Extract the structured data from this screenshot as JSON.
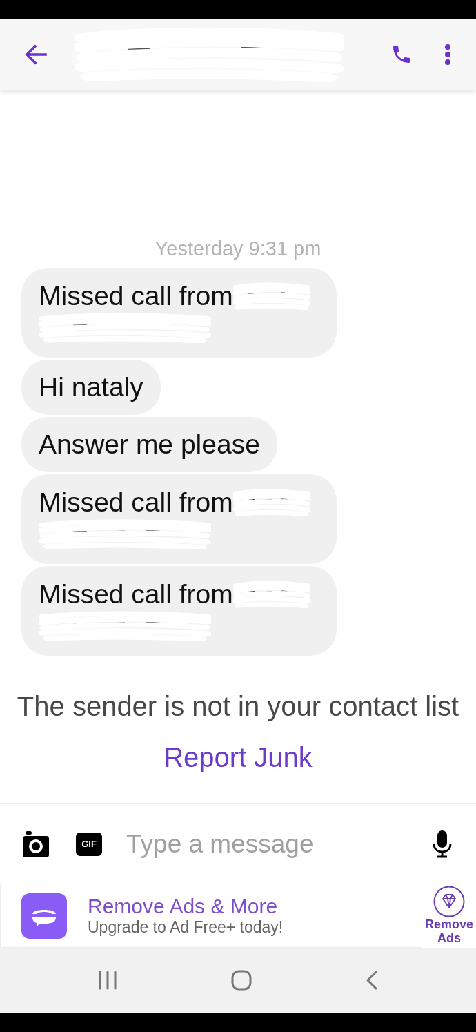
{
  "timestamp": "Yesterday 9:31 pm",
  "messages": [
    {
      "kind": "missed_call",
      "text": "Missed call from"
    },
    {
      "kind": "text",
      "text": "Hi nataly"
    },
    {
      "kind": "text",
      "text": "Answer me please"
    },
    {
      "kind": "missed_call",
      "text": "Missed call from"
    },
    {
      "kind": "missed_call",
      "text": "Missed call from"
    }
  ],
  "notice": {
    "text": "The sender is not in your contact list",
    "action": "Report Junk"
  },
  "composer": {
    "gif_label": "GIF",
    "placeholder": "Type a message"
  },
  "ad_banner": {
    "title": "Remove Ads & More",
    "subtitle": "Upgrade to Ad Free+ today!",
    "button": "Remove Ads"
  }
}
